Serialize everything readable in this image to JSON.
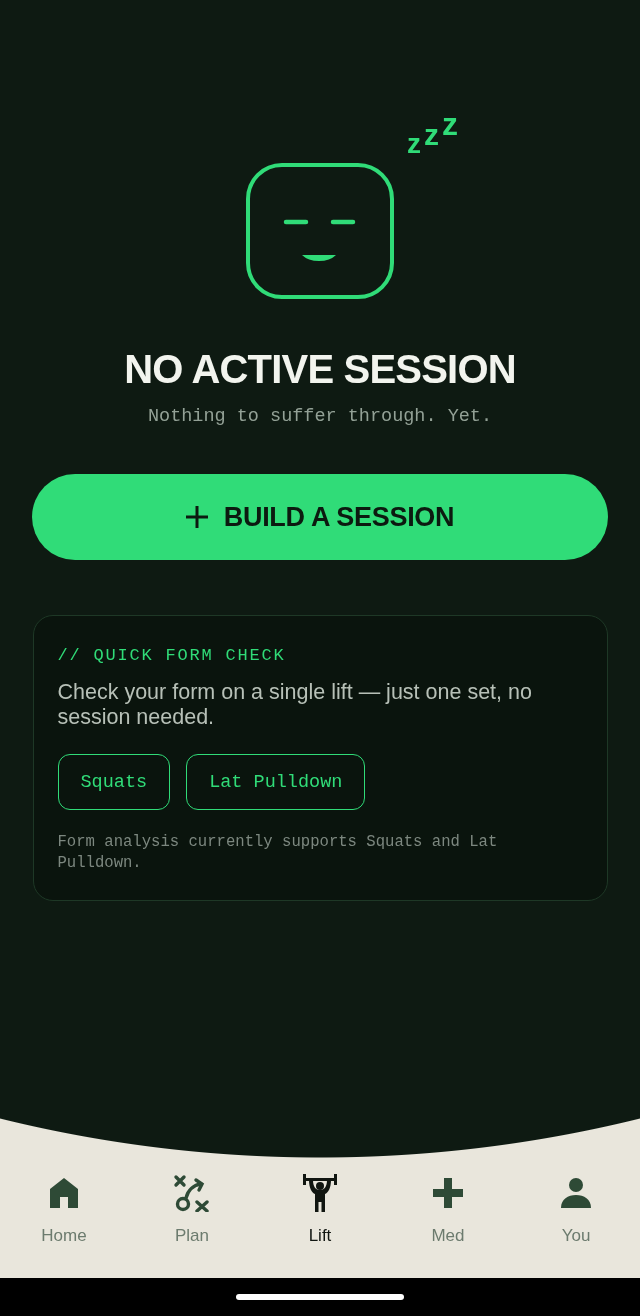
{
  "hero": {
    "sleep_mark": "zzz",
    "title": "NO ACTIVE SESSION",
    "subtitle": "Nothing to suffer through. Yet."
  },
  "primary_action": {
    "label": "BUILD A SESSION"
  },
  "form_check": {
    "heading": "// QUICK FORM CHECK",
    "description": "Check your form on a single lift — just one set, no session needed.",
    "lifts": [
      "Squats",
      "Lat Pulldown"
    ],
    "note": "Form analysis currently supports Squats and Lat Pulldown."
  },
  "tab_bar": {
    "tabs": [
      {
        "label": "Home",
        "selected": false
      },
      {
        "label": "Plan",
        "selected": false
      },
      {
        "label": "Lift",
        "selected": true
      },
      {
        "label": "Med",
        "selected": false
      },
      {
        "label": "You",
        "selected": false
      }
    ]
  }
}
